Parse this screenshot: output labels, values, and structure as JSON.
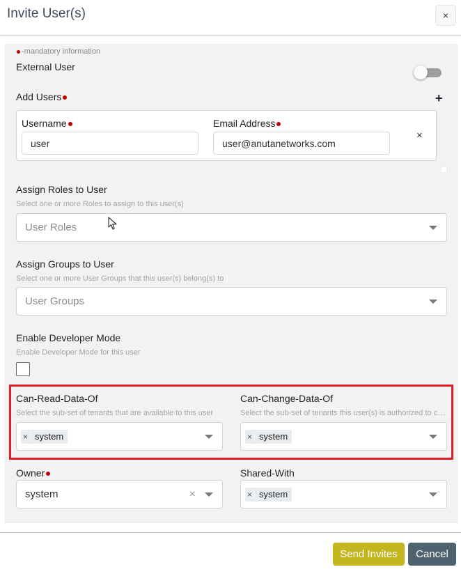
{
  "modal": {
    "title": "Invite User(s)",
    "close_label": "×"
  },
  "form": {
    "mandatory_note": "-mandatory information",
    "external_user": {
      "label": "External User",
      "enabled": false
    },
    "add_users": {
      "label": "Add Users",
      "add_icon": "plus-icon",
      "username_label": "Username",
      "username_value": "user",
      "email_label": "Email Address",
      "email_value": "user@anutanetworks.com",
      "remove_label": "×"
    },
    "roles": {
      "label": "Assign Roles to User",
      "help": "Select one or more Roles to assign to this user(s)",
      "placeholder": "User Roles"
    },
    "groups": {
      "label": "Assign Groups to User",
      "help": "Select one or more User Groups that this user(s) belong(s) to",
      "placeholder": "User Groups"
    },
    "developer_mode": {
      "label": "Enable Developer Mode",
      "help": "Enable Developer Mode for this user",
      "checked": false
    },
    "can_read": {
      "label": "Can-Read-Data-Of",
      "help": "Select the sub-set of tenants that are available to this user",
      "tags": [
        "system"
      ]
    },
    "can_change": {
      "label": "Can-Change-Data-Of",
      "help": "Select the sub-set of tenants this user(s) is authorized to change",
      "tags": [
        "system"
      ]
    },
    "owner": {
      "label": "Owner",
      "value": "system",
      "clear_label": "×"
    },
    "shared_with": {
      "label": "Shared-With",
      "tags": [
        "system"
      ]
    }
  },
  "footer": {
    "send_label": "Send Invites",
    "cancel_label": "Cancel"
  },
  "colors": {
    "required_dot": "#c00000",
    "highlight_border": "#e01e2b",
    "send_button": "#c4b61f",
    "cancel_button": "#4f626f"
  },
  "tag_remove_label": "×"
}
